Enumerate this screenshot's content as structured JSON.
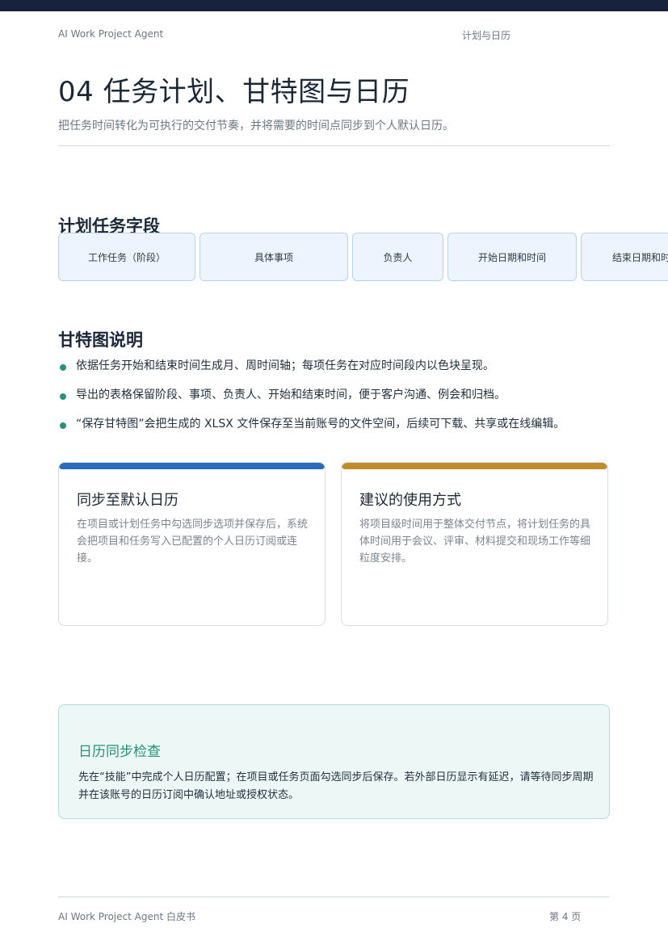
{
  "header": {
    "left": "AI Work Project Agent",
    "right": "计划与日历"
  },
  "page": {
    "title": "04 任务计划、甘特图与日历",
    "subtitle": "把任务时间转化为可执行的交付节奏，并将需要的时间点同步到个人默认日历。"
  },
  "fields_section": {
    "heading": "计划任务字段",
    "items": [
      "工作任务（阶段）",
      "具体事项",
      "负责人",
      "开始日期和时间",
      "结束日期和时间"
    ]
  },
  "gantt_section": {
    "heading": "甘特图说明",
    "bullets": [
      "依据任务开始和结束时间生成月、周时间轴；每项任务在对应时间段内以色块呈现。",
      "导出的表格保留阶段、事项、负责人、开始和结束时间，便于客户沟通、例会和归档。",
      "“保存甘特图”会把生成的 XLSX 文件保存至当前账号的文件空间，后续可下载、共享或在线编辑。"
    ]
  },
  "cards": [
    {
      "title": "同步至默认日历",
      "body": "在项目或计划任务中勾选同步选项并保存后，系统会把项目和任务写入已配置的个人日历订阅或连接。",
      "accent": "#2b6cb8"
    },
    {
      "title": "建议的使用方式",
      "body": "将项目级时间用于整体交付节点，将计划任务的具体时间用于会议、评审、材料提交和现场工作等细粒度安排。",
      "accent": "#c08c2c"
    }
  ],
  "callout": {
    "title": "日历同步检查",
    "body": "先在“技能”中完成个人日历配置；在项目或任务页面勾选同步后保存。若外部日历显示有延迟，请等待同步周期并在该账号的日历订阅中确认地址或授权状态。"
  },
  "footer": {
    "left": "AI Work Project Agent 白皮书",
    "right": "第 4 页"
  }
}
